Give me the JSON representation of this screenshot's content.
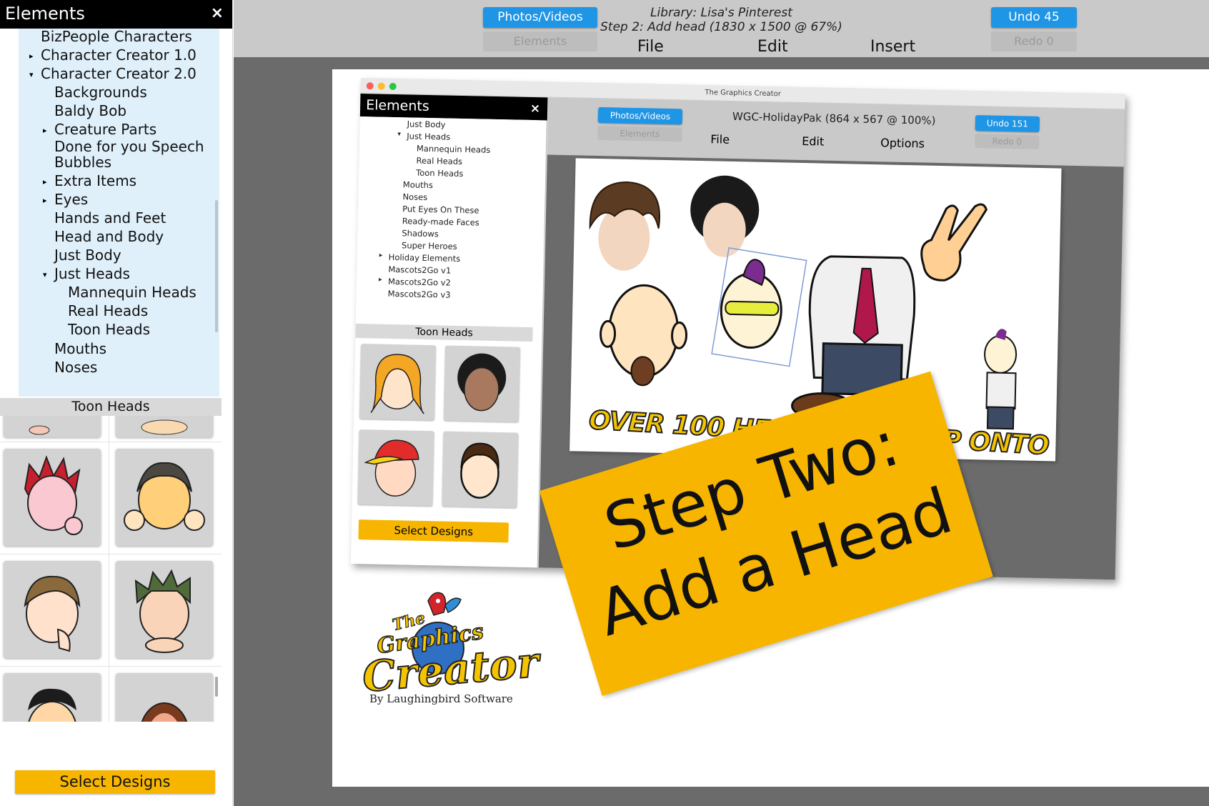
{
  "left_panel": {
    "title": "Elements",
    "close": "×",
    "tree": [
      {
        "label": "BizPeople Characters",
        "arrow": ""
      },
      {
        "label": "Character Creator 1.0",
        "arrow": "▸"
      },
      {
        "label": "Character Creator 2.0",
        "arrow": "▾"
      },
      {
        "label": "Backgrounds",
        "arrow": ""
      },
      {
        "label": "Baldy Bob",
        "arrow": ""
      },
      {
        "label": "Creature Parts",
        "arrow": "▸"
      },
      {
        "label": "Done for you Speech Bubbles",
        "arrow": ""
      },
      {
        "label": "Extra Items",
        "arrow": "▸"
      },
      {
        "label": "Eyes",
        "arrow": "▸"
      },
      {
        "label": "Hands and Feet",
        "arrow": ""
      },
      {
        "label": "Head and Body",
        "arrow": ""
      },
      {
        "label": "Just Body",
        "arrow": ""
      },
      {
        "label": "Just Heads",
        "arrow": "▾"
      },
      {
        "label": "Mannequin Heads",
        "arrow": ""
      },
      {
        "label": "Real Heads",
        "arrow": ""
      },
      {
        "label": "Toon Heads",
        "arrow": ""
      },
      {
        "label": "Mouths",
        "arrow": ""
      },
      {
        "label": "Noses",
        "arrow": ""
      }
    ],
    "subheader": "Toon Heads",
    "select_button": "Select Designs"
  },
  "topbar": {
    "photos_videos": "Photos/Videos",
    "elements": "Elements",
    "library_line": "Library: Lisa's Pinterest",
    "step_line": "Step 2: Add head (1830 x 1500 @ 67%)",
    "menu": [
      "File",
      "Edit",
      "Insert"
    ],
    "undo": "Undo 45",
    "redo": "Redo 0"
  },
  "inner_app": {
    "window_title": "The Graphics Creator",
    "panel_title": "Elements",
    "close": "×",
    "tree": [
      {
        "label": "Just Body",
        "arrow": ""
      },
      {
        "label": "Just Heads",
        "arrow": "▾"
      },
      {
        "label": "Mannequin Heads",
        "arrow": ""
      },
      {
        "label": "Real Heads",
        "arrow": ""
      },
      {
        "label": "Toon Heads",
        "arrow": ""
      },
      {
        "label": "Mouths",
        "arrow": ""
      },
      {
        "label": "Noses",
        "arrow": ""
      },
      {
        "label": "Put Eyes On These",
        "arrow": ""
      },
      {
        "label": "Ready-made Faces",
        "arrow": ""
      },
      {
        "label": "Shadows",
        "arrow": ""
      },
      {
        "label": "Super Heroes",
        "arrow": ""
      },
      {
        "label": "Holiday Elements",
        "arrow": "▸"
      },
      {
        "label": "Mascots2Go v1",
        "arrow": ""
      },
      {
        "label": "Mascots2Go v2",
        "arrow": "▸"
      },
      {
        "label": "Mascots2Go v3",
        "arrow": ""
      }
    ],
    "subheader": "Toon Heads",
    "select_button": "Select Designs",
    "photos_videos": "Photos/Videos",
    "elements": "Elements",
    "doc_title": "WGC-HolidayPak (864 x 567 @ 100%)",
    "menu": [
      "File",
      "Edit",
      "Options"
    ],
    "undo": "Undo 151",
    "redo": "Redo 0",
    "banner": "OVER 100 HEADS TO DROP ONTO BODIES"
  },
  "sticky_note": {
    "line1": "Step Two:",
    "line2": "Add a Head"
  },
  "logo": {
    "word1": "The",
    "word2": "Graphics",
    "word3": "Creator",
    "subtitle": "By Laughingbird Software"
  },
  "colors": {
    "accent_blue": "#1f95e6",
    "accent_yellow": "#f7b500",
    "tree_bg": "#dff0fb",
    "workspace_gray": "#6b6b6b",
    "toolbar_gray": "#c9c9c9"
  },
  "icons": {
    "close": "close-icon",
    "expand": "triangle-right-icon",
    "collapse": "triangle-down-icon"
  }
}
